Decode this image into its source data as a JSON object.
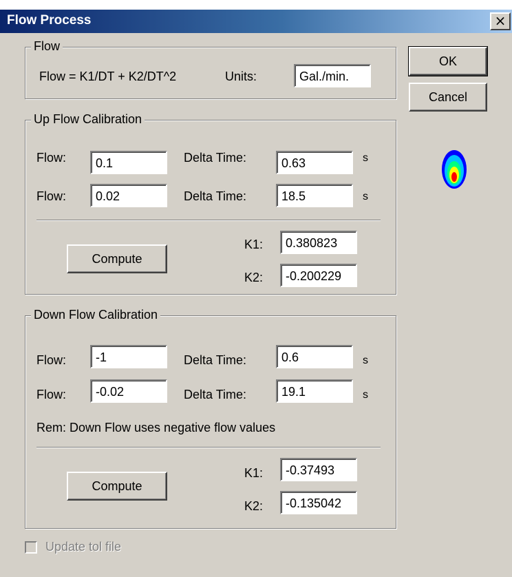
{
  "window": {
    "title": "Flow Process",
    "close_glyph": "×"
  },
  "flow_group": {
    "legend": "Flow",
    "formula": "Flow = K1/DT + K2/DT^2",
    "units_label": "Units:",
    "units_value": "Gal./min."
  },
  "buttons": {
    "ok": "OK",
    "cancel": "Cancel"
  },
  "up_flow": {
    "legend": "Up Flow Calibration",
    "rows": [
      {
        "flow_label": "Flow:",
        "flow": "0.1",
        "dt_label": "Delta Time:",
        "dt": "0.63",
        "unit": "s"
      },
      {
        "flow_label": "Flow:",
        "flow": "0.02",
        "dt_label": "Delta Time:",
        "dt": "18.5",
        "unit": "s"
      }
    ],
    "compute_label": "Compute",
    "k1_label": "K1:",
    "k1": "0.380823",
    "k2_label": "K2:",
    "k2": "-0.200229"
  },
  "down_flow": {
    "legend": "Down Flow Calibration",
    "rows": [
      {
        "flow_label": "Flow:",
        "flow": "-1",
        "dt_label": "Delta Time:",
        "dt": "0.6",
        "unit": "s"
      },
      {
        "flow_label": "Flow:",
        "flow": "-0.02",
        "dt_label": "Delta Time:",
        "dt": "19.1",
        "unit": "s"
      }
    ],
    "remark": "Rem: Down Flow uses negative flow values",
    "compute_label": "Compute",
    "k1_label": "K1:",
    "k1": "-0.37493",
    "k2_label": "K2:",
    "k2": "-0.135042"
  },
  "update_checkbox": {
    "label": "Update tol file",
    "checked": false,
    "enabled": false
  },
  "icon": {
    "name": "flow-drop-icon",
    "colors": [
      "#0000ff",
      "#00c0ff",
      "#00ff80",
      "#ffff00",
      "#ff0000"
    ]
  }
}
